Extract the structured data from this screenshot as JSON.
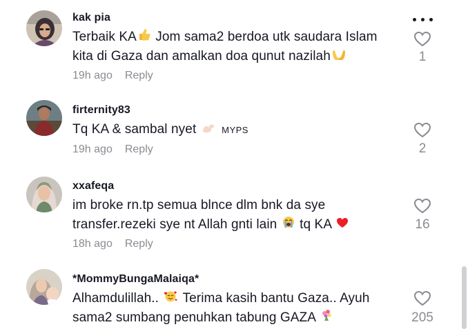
{
  "comments": [
    {
      "username": "kak pia",
      "line1": "Terbaik KA",
      "line1_b": "Jom sama2 berdoa utk saudara Islam",
      "line2": "kita di Gaza dan amalkan doa qunut nazilah",
      "time": "19h ago",
      "reply": "Reply",
      "likes": "1",
      "icons": [
        "thumbs-up-emoji",
        "open-hands-emoji"
      ]
    },
    {
      "username": "firternity83",
      "line1": "Tq KA & sambal nyet",
      "tag": "MYPS",
      "time": "19h ago",
      "reply": "Reply",
      "likes": "2",
      "icons": [
        "flexed-biceps-emoji"
      ]
    },
    {
      "username": "xxafeqa",
      "line1": "im broke rn.tp semua blnce dlm bnk da sye",
      "line2_a": "transfer.rezeki sye nt Allah gnti lain",
      "line2_b": "tq KA",
      "time": "18h ago",
      "reply": "Reply",
      "likes": "16",
      "icons": [
        "loudly-crying-face-emoji",
        "red-heart-emoji"
      ]
    },
    {
      "username": "*MommyBungaMalaiqa*",
      "line1_a": "Alhamdulillah..",
      "line1_b": "Terima kasih bantu Gaza.. Ayuh",
      "line2": "sama2 sumbang penuhkan tabung GAZA",
      "likes": "205",
      "icons": [
        "smiling-face-with-hearts-emoji",
        "bouquet-emoji"
      ]
    }
  ],
  "icons": {
    "more": "more-options-icon",
    "like": "heart-outline-icon"
  },
  "colors": {
    "text": "#161823",
    "muted": "#8a8b91",
    "heart": "#ee1d52"
  }
}
